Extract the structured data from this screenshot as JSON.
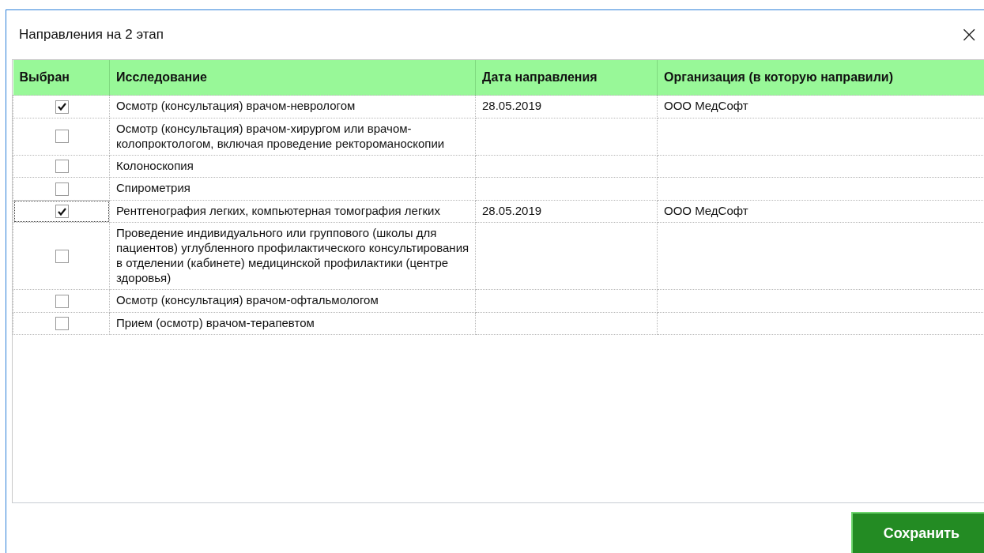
{
  "window": {
    "title": "Направления на 2 этап",
    "close": "×"
  },
  "table": {
    "columns": [
      "Выбран",
      "Исследование",
      "Дата направления",
      "Организация (в которую направили)"
    ],
    "rows": [
      {
        "checked": true,
        "focused": false,
        "study": "Осмотр (консультация) врачом-неврологом",
        "date": "28.05.2019",
        "organization": "ООО МедСофт"
      },
      {
        "checked": false,
        "focused": false,
        "study": "Осмотр (консультация) врачом-хирургом или врачом-колопроктологом, включая проведение ректороманоскопии"
      },
      {
        "checked": false,
        "focused": false,
        "study": "Колоноскопия"
      },
      {
        "checked": false,
        "focused": false,
        "study": "Спирометрия"
      },
      {
        "checked": true,
        "focused": true,
        "study": "Рентгенография легких, компьютерная томография легких",
        "date": "28.05.2019",
        "organization": "ООО МедСофт"
      },
      {
        "checked": false,
        "focused": false,
        "study": "Проведение индивидуального или группового (школы для пациентов) углубленного профилактического консультирования в отделении (кабинете) медицинской профилактики (центре здоровья)"
      },
      {
        "checked": false,
        "focused": false,
        "study": "Осмотр (консультация) врачом-офтальмологом"
      },
      {
        "checked": false,
        "focused": false,
        "study": "Прием (осмотр) врачом-терапевтом"
      }
    ]
  },
  "buttons": {
    "save": "Сохранить"
  }
}
